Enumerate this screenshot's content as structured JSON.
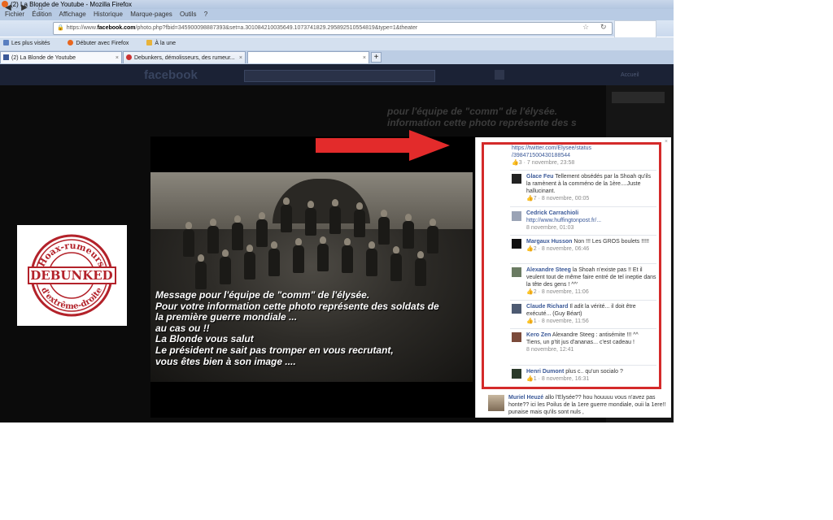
{
  "window": {
    "title": "(2) La Blonde de Youtube - Mozilla Firefox",
    "menu": [
      "Fichier",
      "Édition",
      "Affichage",
      "Historique",
      "Marque-pages",
      "Outils",
      "?"
    ]
  },
  "address_bar": {
    "scheme": "https://www.",
    "domain": "facebook.com",
    "path": "/photo.php?fbid=345900098887393&set=a.301084210035649.1073741829.295892510554819&type=1&theater"
  },
  "bookmarks": [
    "Les plus visités",
    "Débuter avec Firefox",
    "À la une"
  ],
  "tabs": [
    {
      "label": "(2) La Blonde de Youtube"
    },
    {
      "label": "Debunkers, démolisseurs, des rumeur..."
    },
    {
      "label": ""
    }
  ],
  "facebook": {
    "logo": "facebook",
    "nav": [
      "Accueil"
    ]
  },
  "photo": {
    "caption_lines": [
      "Message pour l'équipe de \"comm\" de l'élysée.",
      "Pour votre information cette photo représente des soldats de",
      "la première guerre mondiale ...",
      "au cas ou !!",
      "La Blonde vous salut",
      "Le président ne sait pas tromper en vous recrutant,",
      "vous êtes bien à son image  ...."
    ],
    "background_caption_lines": [
      "pour l'équipe de \"comm\" de l'élysée.",
      "information cette photo représente des s"
    ]
  },
  "logo": {
    "top_text": "Hoax-rumeurs",
    "stamp": "DEBUNKED",
    "bottom_text": "d'extrême-droite"
  },
  "comments": [
    {
      "author": "",
      "text": "",
      "link": "https://twitter.com/Elysee/status/398471500430188544",
      "link_line1": "https://twitter.com/Elysee/status",
      "link_line2": "/398471500430188544",
      "likes": "3",
      "date": "7 novembre, 23:58"
    },
    {
      "author": "Glace Feu",
      "text": "Tellement obsédés par la Shoah qu'ils la ramènent à la comméno de la 1ère....Juste hallucinant.",
      "likes": "7",
      "date": "8 novembre, 00:05"
    },
    {
      "author": "Cedrick Carrachioli",
      "text": "",
      "link": "http://www.huffingtonpost.fr/...",
      "likes": "",
      "date": "8 novembre, 01:03"
    },
    {
      "author": "Margaux Husson",
      "text": "Non !!! Les GROS boulets !!!!!",
      "likes": "2",
      "date": "8 novembre, 06:46"
    },
    {
      "author": "Alexandre Steeg",
      "text": "la Shoah n'existe pas !! Et il veulent tout de même faire entré de tel ineptie dans la tête des gens ! ^^'",
      "likes": "2",
      "date": "8 novembre, 11:06"
    },
    {
      "author": "Claude Richard",
      "text": "Il adit la vérité... il doit être exécuté... (Guy Béart)",
      "likes": "1",
      "date": "8 novembre, 11:56"
    },
    {
      "author": "Kero Zen",
      "text": "Alexandre Steeg : antisémite !!! ^^",
      "text2": "Tiens, un p'tit jus d'ananas... c'est cadeau !",
      "likes": "",
      "date": "8 novembre, 12:41"
    },
    {
      "author": "Henri Dumont",
      "text": "plus c.. qu'un socialo ?",
      "likes": "1",
      "date": "8 novembre, 16:31"
    }
  ],
  "bottom_comment": {
    "author": "Muriel Heuzé",
    "text": "allo l'Elysée?? hou houuuu vous n'avez pas honte?? ici les Poilus de la 1ere guerre mondiale, ouii la 1ere!! punaise mais qu'ils sont nuls ,"
  },
  "colors": {
    "accent_red": "#d42a2a",
    "facebook_blue": "#3b5998"
  }
}
